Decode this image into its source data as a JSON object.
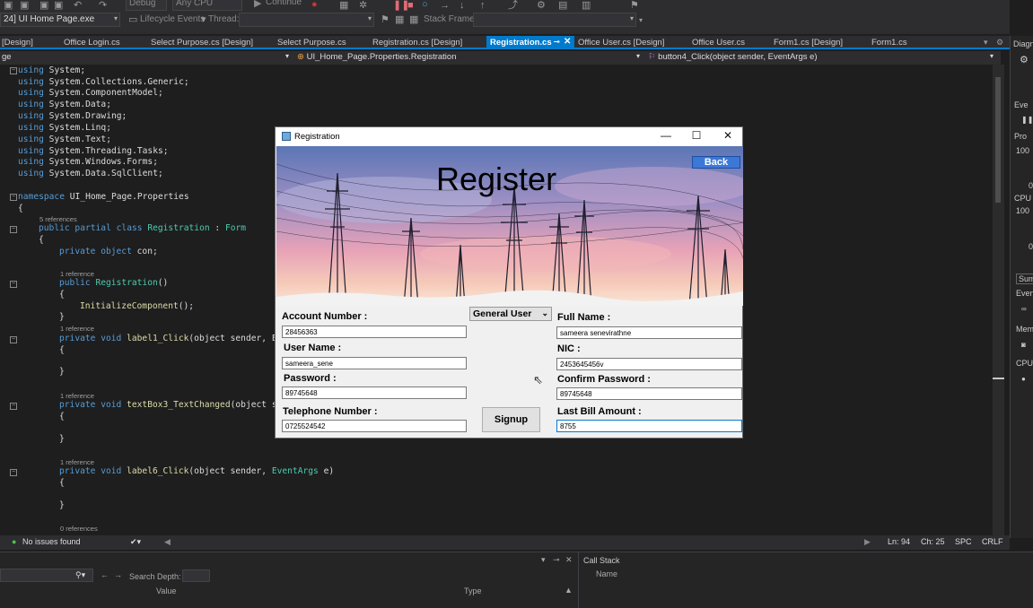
{
  "toolbar": {
    "process_label": "24] UI Home Page.exe",
    "lifecycle_label": "Lifecycle Events",
    "thread_label": "Thread:",
    "stackframe_label": "Stack Frame:",
    "debug_label": "Debug",
    "cpu_label": "Any CPU",
    "continue_label": "Continue"
  },
  "tabs": [
    {
      "label": "[Design]"
    },
    {
      "label": "Office Login.cs"
    },
    {
      "label": "Select Purpose.cs [Design]"
    },
    {
      "label": "Select Purpose.cs"
    },
    {
      "label": "Registration.cs [Design]"
    },
    {
      "label": "Registration.cs"
    },
    {
      "label": "Office User.cs [Design]"
    },
    {
      "label": "Office User.cs"
    },
    {
      "label": "Form1.cs [Design]"
    },
    {
      "label": "Form1.cs"
    }
  ],
  "navbar": {
    "project": "ge",
    "class": "UI_Home_Page.Properties.Registration",
    "member": "button4_Click(object sender, EventArgs e)"
  },
  "code": {
    "using_kw": "using",
    "usings": [
      "System;",
      "System.Collections.Generic;",
      "System.ComponentModel;",
      "System.Data;",
      "System.Drawing;",
      "System.Linq;",
      "System.Text;",
      "System.Threading.Tasks;",
      "System.Windows.Forms;",
      "System.Data.SqlClient;"
    ],
    "namespace_kw": "namespace",
    "namespace_name": "UI_Home_Page.Properties",
    "brace_open": "{",
    "brace_close": "}",
    "refs_5": "5 references",
    "refs_1": "1 reference",
    "refs_0": "0 references",
    "class_kw": "public partial class",
    "class_name": "Registration",
    "class_colon": ":",
    "class_base": "Form",
    "field_kw": "private object",
    "field_name": "con;",
    "ctor_kw": "public",
    "ctor_name": "Registration",
    "ctor_paren": "()",
    "init_call": "InitializeComponent",
    "init_tail": "();",
    "method_kw": "private void",
    "m1_name": "label1_Click",
    "m1_args": "(object sender, E",
    "m2_name": "textBox3_TextChanged",
    "m2_args": "(object s",
    "m3_name": "label6_Click",
    "m3_args_a": "(object sender,",
    "m3_args_type": "EventArgs",
    "m3_args_b": "e)"
  },
  "right_panel": {
    "title": "Diagn",
    "events": "Eve",
    "proc": "Pro",
    "v100a": "100",
    "v0a": "0",
    "cpu": "CPU",
    "v100b": "100",
    "v0b": "0",
    "sum": "Sum",
    "even": "Even",
    "mem": "Mem",
    "cpu2": "CPU"
  },
  "status": {
    "issues": "No issues found",
    "ln": "Ln: 94",
    "ch": "Ch: 25",
    "spc": "SPC",
    "crlf": "CRLF"
  },
  "bottom": {
    "search_depth": "Search Depth:",
    "col_value": "Value",
    "col_type": "Type",
    "call_stack": "Call Stack",
    "col_name": "Name"
  },
  "dialog": {
    "title": "Registration",
    "heading": "Register",
    "back": "Back",
    "user_type": "General User",
    "signup": "Signup",
    "labels": {
      "account_number": "Account Number :",
      "user_name": "User Name :",
      "password": "Password :",
      "telephone": "Telephone Number :",
      "full_name": "Full Name :",
      "nic": "NIC :",
      "confirm_password": "Confirm Password :",
      "last_bill": "Last Bill Amount :"
    },
    "values": {
      "account_number": "28456363",
      "user_name": "sameera_sene",
      "password": "89745648",
      "telephone": "0725524542",
      "full_name": "sameera senevirathne",
      "nic": "2453645456v",
      "confirm_password": "89745648",
      "last_bill": "8755"
    }
  },
  "colors": {
    "accent": "#007acc",
    "back_button": "#3c78d8"
  }
}
